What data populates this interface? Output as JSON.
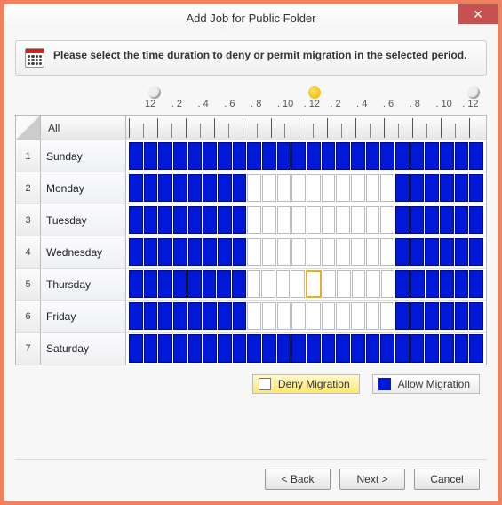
{
  "window": {
    "title": "Add Job for Public Folder"
  },
  "info": {
    "text": "Please select the time duration to deny or permit migration in the selected period."
  },
  "hours": {
    "labels": [
      "12",
      "2",
      "4",
      "6",
      "8",
      "10",
      "12",
      "2",
      "4",
      "6",
      "8",
      "10",
      "12"
    ]
  },
  "grid": {
    "all_label": "All",
    "days": [
      {
        "num": "1",
        "name": "Sunday"
      },
      {
        "num": "2",
        "name": "Monday"
      },
      {
        "num": "3",
        "name": "Tuesday"
      },
      {
        "num": "4",
        "name": "Wednesday"
      },
      {
        "num": "5",
        "name": "Thursday"
      },
      {
        "num": "6",
        "name": "Friday"
      },
      {
        "num": "7",
        "name": "Saturday"
      }
    ]
  },
  "legend": {
    "deny": "Deny Migration",
    "allow": "Allow Migration"
  },
  "buttons": {
    "back": "< Back",
    "next": "Next >",
    "cancel": "Cancel"
  },
  "chart_data": {
    "type": "heatmap",
    "note": "24 hourly slots per weekday; 1 = Allow Migration (blue), 0 = Deny Migration (white). Cursor cell at Thursday hour index 12.",
    "hours": [
      0,
      1,
      2,
      3,
      4,
      5,
      6,
      7,
      8,
      9,
      10,
      11,
      12,
      13,
      14,
      15,
      16,
      17,
      18,
      19,
      20,
      21,
      22,
      23
    ],
    "rows": [
      "Sunday",
      "Monday",
      "Tuesday",
      "Wednesday",
      "Thursday",
      "Friday",
      "Saturday"
    ],
    "values": [
      [
        1,
        1,
        1,
        1,
        1,
        1,
        1,
        1,
        1,
        1,
        1,
        1,
        1,
        1,
        1,
        1,
        1,
        1,
        1,
        1,
        1,
        1,
        1,
        1
      ],
      [
        1,
        1,
        1,
        1,
        1,
        1,
        1,
        1,
        0,
        0,
        0,
        0,
        0,
        0,
        0,
        0,
        0,
        0,
        1,
        1,
        1,
        1,
        1,
        1
      ],
      [
        1,
        1,
        1,
        1,
        1,
        1,
        1,
        1,
        0,
        0,
        0,
        0,
        0,
        0,
        0,
        0,
        0,
        0,
        1,
        1,
        1,
        1,
        1,
        1
      ],
      [
        1,
        1,
        1,
        1,
        1,
        1,
        1,
        1,
        0,
        0,
        0,
        0,
        0,
        0,
        0,
        0,
        0,
        0,
        1,
        1,
        1,
        1,
        1,
        1
      ],
      [
        1,
        1,
        1,
        1,
        1,
        1,
        1,
        1,
        0,
        0,
        0,
        0,
        0,
        0,
        0,
        0,
        0,
        0,
        1,
        1,
        1,
        1,
        1,
        1
      ],
      [
        1,
        1,
        1,
        1,
        1,
        1,
        1,
        1,
        0,
        0,
        0,
        0,
        0,
        0,
        0,
        0,
        0,
        0,
        1,
        1,
        1,
        1,
        1,
        1
      ],
      [
        1,
        1,
        1,
        1,
        1,
        1,
        1,
        1,
        1,
        1,
        1,
        1,
        1,
        1,
        1,
        1,
        1,
        1,
        1,
        1,
        1,
        1,
        1,
        1
      ]
    ],
    "cursor": {
      "day": "Thursday",
      "hour_index": 12
    }
  }
}
